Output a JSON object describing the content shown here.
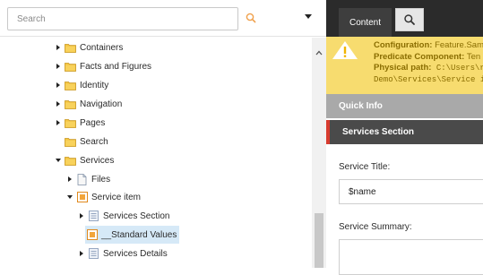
{
  "search": {
    "placeholder": "Search",
    "icon": "magnifier-icon",
    "dropdown_icon": "caret-down-icon"
  },
  "tree": {
    "items": [
      {
        "label": "Containers",
        "expander": "collapsed",
        "icon": "folder"
      },
      {
        "label": "Facts and Figures",
        "expander": "collapsed",
        "icon": "folder"
      },
      {
        "label": "Identity",
        "expander": "collapsed",
        "icon": "folder"
      },
      {
        "label": "Navigation",
        "expander": "collapsed",
        "icon": "folder"
      },
      {
        "label": "Pages",
        "expander": "collapsed",
        "icon": "folder"
      },
      {
        "label": "Search",
        "expander": "none",
        "icon": "folder"
      },
      {
        "label": "Services",
        "expander": "expanded",
        "icon": "folder"
      },
      {
        "label": "Files",
        "expander": "collapsed",
        "icon": "document"
      },
      {
        "label": "Service item",
        "expander": "expanded",
        "icon": "template"
      },
      {
        "label": "Services Section",
        "expander": "collapsed",
        "icon": "section"
      },
      {
        "label": "__Standard Values",
        "expander": "none",
        "icon": "template",
        "selected": true
      },
      {
        "label": "Services Details",
        "expander": "collapsed",
        "icon": "section"
      }
    ]
  },
  "tabs": {
    "content_label": "Content",
    "search_icon": "magnifier-icon"
  },
  "warning": {
    "icon": "warning-triangle-icon",
    "line1_key": "Configuration:",
    "line1_val": " Feature.Sam",
    "line2_key": "Predicate Component:",
    "line2_val": " Ten",
    "line3_key": "Physical path:",
    "line3_val": " C:\\Users\\ro",
    "line4": "Demo\\Services\\Service i"
  },
  "sections": {
    "quick_info": "Quick Info",
    "services_section": "Services Section"
  },
  "fields": {
    "service_title_label": "Service Title:",
    "service_title_value": "$name",
    "service_summary_label": "Service Summary:"
  },
  "colors": {
    "warning_bg": "#f7dc6f",
    "warning_text": "#8a6d00",
    "section_accent": "#d73b2f",
    "selected_row": "#d6e9f7",
    "tab_bar": "#2b2b2b"
  }
}
